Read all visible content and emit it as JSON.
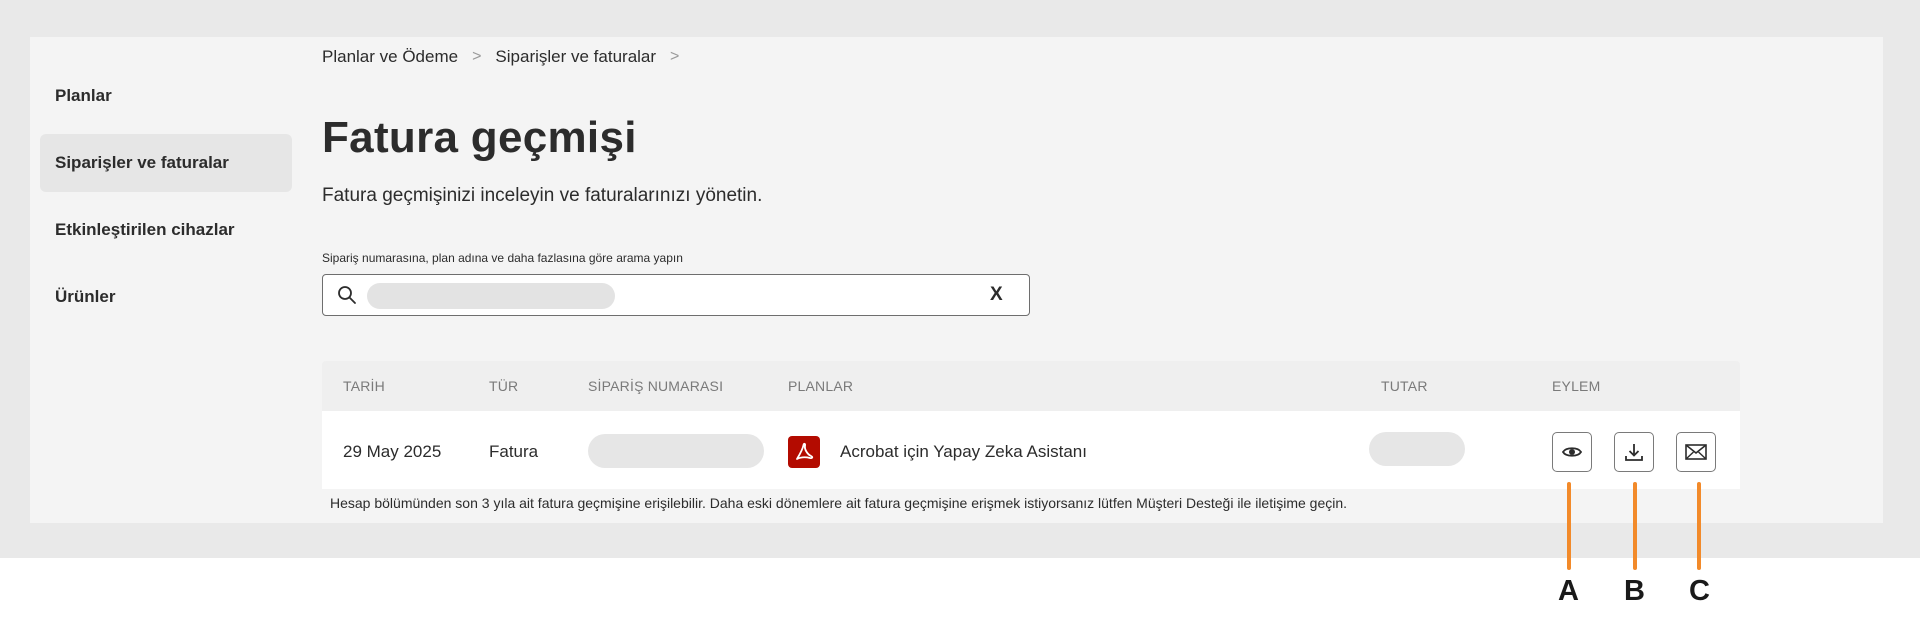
{
  "sidebar": {
    "items": [
      {
        "label": "Planlar",
        "active": false
      },
      {
        "label": "Siparişler ve faturalar",
        "active": true
      },
      {
        "label": "Etkinleştirilen cihazlar",
        "active": false
      },
      {
        "label": "Ürünler",
        "active": false
      }
    ]
  },
  "breadcrumb": {
    "items": [
      "Planlar ve Ödeme",
      "Siparişler ve faturalar"
    ],
    "separator": ">"
  },
  "page": {
    "title": "Fatura geçmişi",
    "subtitle": "Fatura geçmişinizi inceleyin ve faturalarınızı yönetin."
  },
  "search": {
    "label": "Sipariş numarasına, plan adına ve daha fazlasına göre arama yapın",
    "value": "",
    "clear_label": "X"
  },
  "table": {
    "headers": {
      "date": "TARİH",
      "type": "TÜR",
      "order": "SİPARİŞ NUMARASI",
      "plans": "PLANLAR",
      "amount": "TUTAR",
      "action": "EYLEM"
    },
    "rows": [
      {
        "date": "29 May 2025",
        "type": "Fatura",
        "order": "",
        "plan": "Acrobat için Yapay Zeka Asistanı",
        "plan_icon": "acrobat-pdf-icon",
        "amount": ""
      }
    ]
  },
  "actions": [
    {
      "name": "view",
      "icon": "eye-icon",
      "callout": "A"
    },
    {
      "name": "download",
      "icon": "download-icon",
      "callout": "B"
    },
    {
      "name": "email",
      "icon": "mail-icon",
      "callout": "C"
    }
  ],
  "footnote": "Hesap bölümünden son 3 yıla ait fatura geçmişine erişilebilir. Daha eski dönemlere ait fatura geçmişine erişmek istiyorsanız lütfen Müşteri Desteği ile iletişime geçin.",
  "colors": {
    "callout": "#f28a2a",
    "acrobat": "#b30b00",
    "active_nav": "#e6e6e6"
  }
}
